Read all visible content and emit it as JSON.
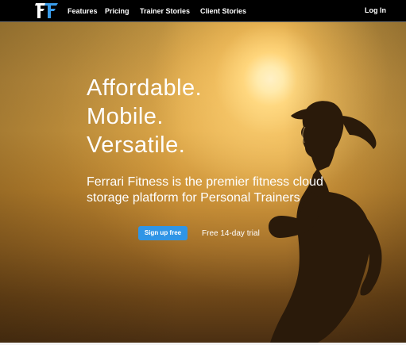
{
  "nav": {
    "links": [
      "Features",
      "Pricing",
      "Trainer Stories",
      "Client Stories"
    ],
    "login_label": "Log In"
  },
  "hero": {
    "headline": [
      "Affordable.",
      "Mobile.",
      "Versatile."
    ],
    "subtitle": "Ferrari Fitness is the premier fitness cloud storage platform for Personal Trainers",
    "cta_label": "Sign up free",
    "trial_text": "Free 14-day trial"
  },
  "colors": {
    "nav_background": "#000000",
    "cta_background": "#2f95e6",
    "logo_white": "#ffffff",
    "logo_blue": "#3a9be8"
  },
  "icons": [
    "ff-logo-icon"
  ]
}
